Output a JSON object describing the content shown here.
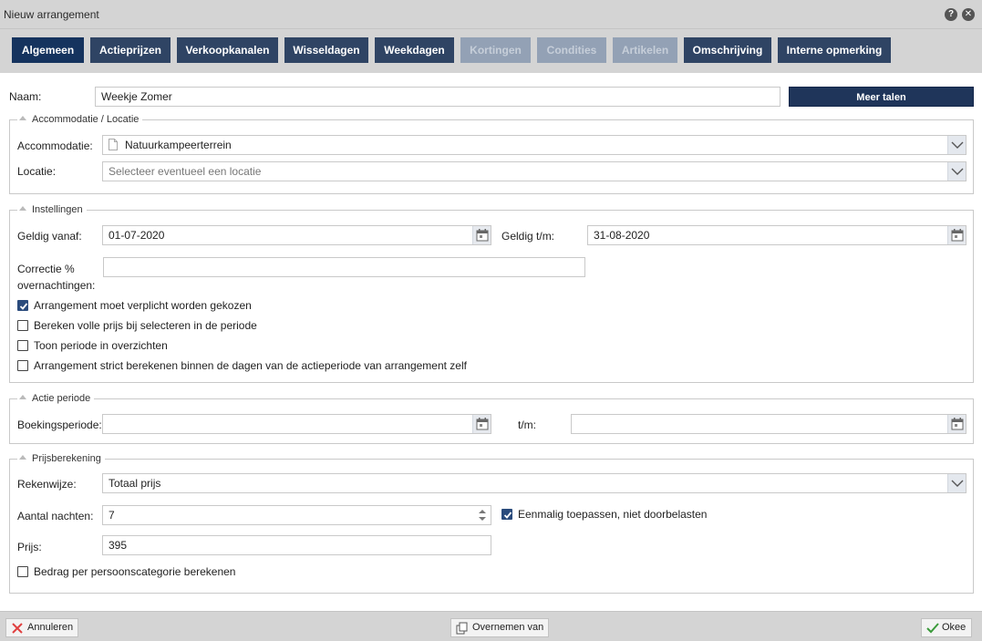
{
  "window": {
    "title": "Nieuw arrangement",
    "help_icon": "question-icon",
    "close_icon": "close-icon"
  },
  "tabs": [
    {
      "label": "Algemeen",
      "state": "active"
    },
    {
      "label": "Actieprijzen",
      "state": "normal"
    },
    {
      "label": "Verkoopkanalen",
      "state": "normal"
    },
    {
      "label": "Wisseldagen",
      "state": "normal"
    },
    {
      "label": "Weekdagen",
      "state": "normal"
    },
    {
      "label": "Kortingen",
      "state": "disabled"
    },
    {
      "label": "Condities",
      "state": "disabled"
    },
    {
      "label": "Artikelen",
      "state": "disabled"
    },
    {
      "label": "Omschrijving",
      "state": "normal"
    },
    {
      "label": "Interne opmerking",
      "state": "normal"
    }
  ],
  "name": {
    "label": "Naam:",
    "value": "Weekje Zomer",
    "more_languages": "Meer talen"
  },
  "accommodation_section": {
    "legend": "Accommodatie / Locatie",
    "accommodation_label": "Accommodatie:",
    "accommodation_value": "Natuurkampeerterrein",
    "location_label": "Locatie:",
    "location_placeholder": "Selecteer eventueel een locatie"
  },
  "settings_section": {
    "legend": "Instellingen",
    "valid_from_label": "Geldig vanaf:",
    "valid_from_value": "01-07-2020",
    "valid_to_label": "Geldig t/m:",
    "valid_to_value": "31-08-2020",
    "correction_label_line1": "Correctie %",
    "correction_label_line2": "overnachtingen:",
    "correction_value": "",
    "checkboxes": [
      {
        "label": "Arrangement moet verplicht worden gekozen",
        "checked": true
      },
      {
        "label": "Bereken volle prijs bij selecteren in de periode",
        "checked": false
      },
      {
        "label": "Toon periode in overzichten",
        "checked": false
      },
      {
        "label": "Arrangement strict berekenen binnen de dagen van de actieperiode van arrangement zelf",
        "checked": false
      }
    ]
  },
  "action_period_section": {
    "legend": "Actie periode",
    "booking_label": "Boekingsperiode:",
    "booking_value": "",
    "to_label": "t/m:",
    "to_value": ""
  },
  "price_section": {
    "legend": "Prijsberekening",
    "method_label": "Rekenwijze:",
    "method_value": "Totaal prijs",
    "nights_label": "Aantal nachten:",
    "nights_value": "7",
    "once_label": "Eenmalig toepassen, niet doorbelasten",
    "once_checked": true,
    "price_label": "Prijs:",
    "price_value": "395",
    "per_person_label": "Bedrag per persoonscategorie berekenen",
    "per_person_checked": false
  },
  "footer": {
    "cancel": "Annuleren",
    "copy_from": "Overnemen van",
    "ok": "Okee"
  },
  "colors": {
    "tab_active": "#15335e",
    "tab": "#2f4464",
    "tab_disabled": "#93a1b5",
    "checkbox": "#2a4b7c"
  }
}
